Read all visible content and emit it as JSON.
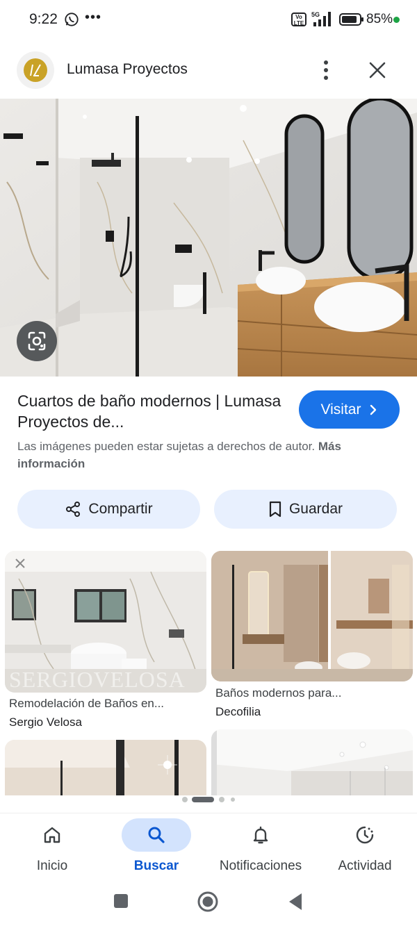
{
  "status_bar": {
    "time": "9:22",
    "network": "5G",
    "volte": "Vo LTE",
    "battery_percent": "85%"
  },
  "header": {
    "site_title": "Lumasa Proyectos",
    "more_icon": "more-vert-icon",
    "close_icon": "close-icon"
  },
  "result": {
    "title": "Cuartos de baño modernos | Lumasa Proyectos de...",
    "visit_label": "Visitar",
    "copyright_text": "Las imágenes pueden estar sujetas a derechos de autor.",
    "more_info": "Más información"
  },
  "actions": {
    "share_label": "Compartir",
    "save_label": "Guardar"
  },
  "related": [
    {
      "title": "Remodelación de Baños en...",
      "source": "Sergio Velosa",
      "watermark": "SERGIOVELOSA"
    },
    {
      "title": "Baños modernos para...",
      "source": "Decofilia"
    }
  ],
  "bottom_nav": [
    {
      "label": "Inicio",
      "icon": "home-icon"
    },
    {
      "label": "Buscar",
      "icon": "search-icon",
      "active": true
    },
    {
      "label": "Notificaciones",
      "icon": "bell-icon"
    },
    {
      "label": "Actividad",
      "icon": "activity-icon"
    }
  ],
  "colors": {
    "accent": "#1a73e8",
    "pill": "#e8f0fe",
    "nav_active_pill": "#d3e3fd",
    "battery_dot": "#1ea446"
  }
}
